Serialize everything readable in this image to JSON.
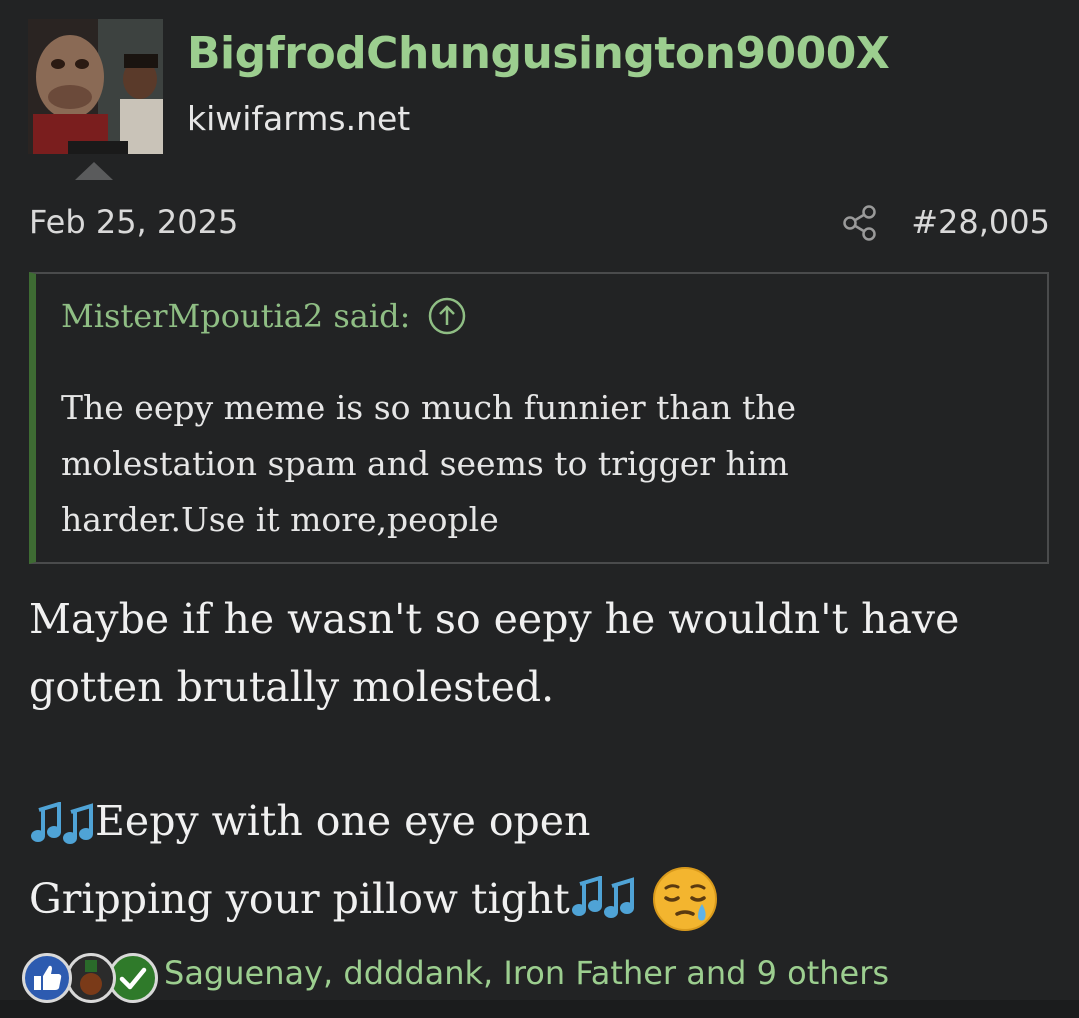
{
  "post": {
    "author": {
      "username": "BigfrodChungusington9000X",
      "user_title": "kiwifarms.net"
    },
    "date": "Feb 25, 2025",
    "post_number": "#28,005",
    "quote": {
      "header": "MisterMpoutia2 said:",
      "lines": [
        "The eepy meme is so much funnier than the",
        "molestation spam and seems to trigger him",
        "harder.Use it more,people"
      ]
    },
    "body": {
      "line1": "Maybe if he wasn't so eepy he wouldn't have",
      "line2": "gotten brutally molested.",
      "lyric1": "Eepy with one eye open",
      "lyric2": "Gripping your pillow tight"
    },
    "reactions": {
      "icons": [
        "thumbs-up-icon",
        "medal-icon",
        "checkmark-icon"
      ],
      "users_text": "Saguenay, ddddank, Iron Father and 9 others"
    }
  },
  "colors": {
    "background": "#222324",
    "username": "#9cce8f",
    "quote_accent": "#3e6b33",
    "quote_header": "#8fbe84",
    "reaction_text": "#9cce8f"
  }
}
